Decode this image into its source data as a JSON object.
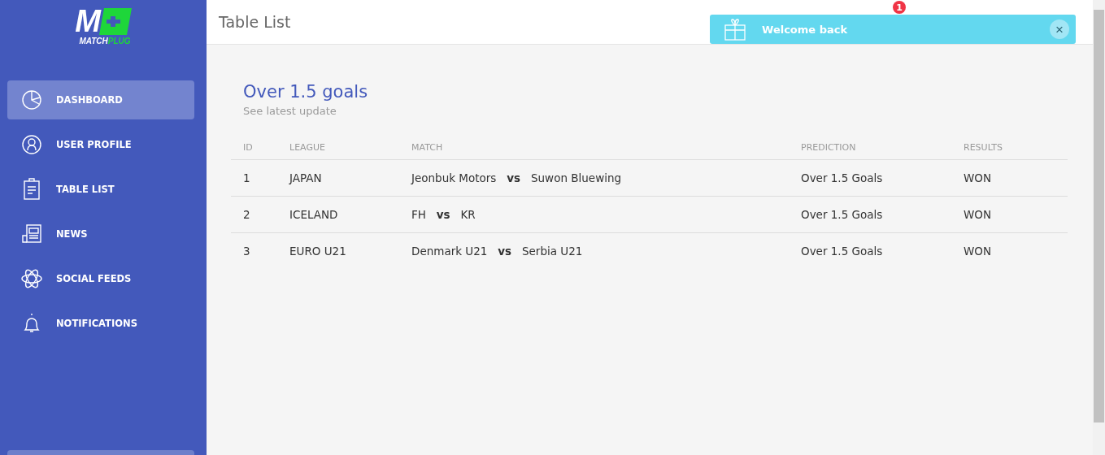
{
  "logo": {
    "mark": "M",
    "word_a": "MATCH",
    "word_b": "PLUG"
  },
  "sidebar": {
    "items": [
      {
        "label": "DASHBOARD",
        "selected": true
      },
      {
        "label": "USER PROFILE",
        "selected": false
      },
      {
        "label": "TABLE LIST",
        "selected": false
      },
      {
        "label": "NEWS",
        "selected": false
      },
      {
        "label": "SOCIAL FEEDS",
        "selected": false
      },
      {
        "label": "NOTIFICATIONS",
        "selected": false
      }
    ]
  },
  "header": {
    "title": "Table List",
    "badge": "1"
  },
  "toast": {
    "message": "Welcome back",
    "close": "×"
  },
  "card": {
    "title": "Over 1.5 goals",
    "subtitle": "See latest update"
  },
  "table": {
    "columns": [
      "ID",
      "LEAGUE",
      "MATCH",
      "PREDICTION",
      "RESULTS"
    ],
    "rows": [
      [
        "1",
        "JAPAN",
        "Jeonbuk Motors   **vs**   Suwon Bluewing",
        "Over 1.5 Goals",
        "WON"
      ],
      [
        "2",
        "ICELAND",
        "FH   **vs**   KR",
        "Over 1.5 Goals",
        "WON"
      ],
      [
        "3",
        "EURO U21",
        "Denmark U21   **vs**   Serbia U21",
        "Over 1.5 Goals",
        "WON"
      ]
    ]
  }
}
